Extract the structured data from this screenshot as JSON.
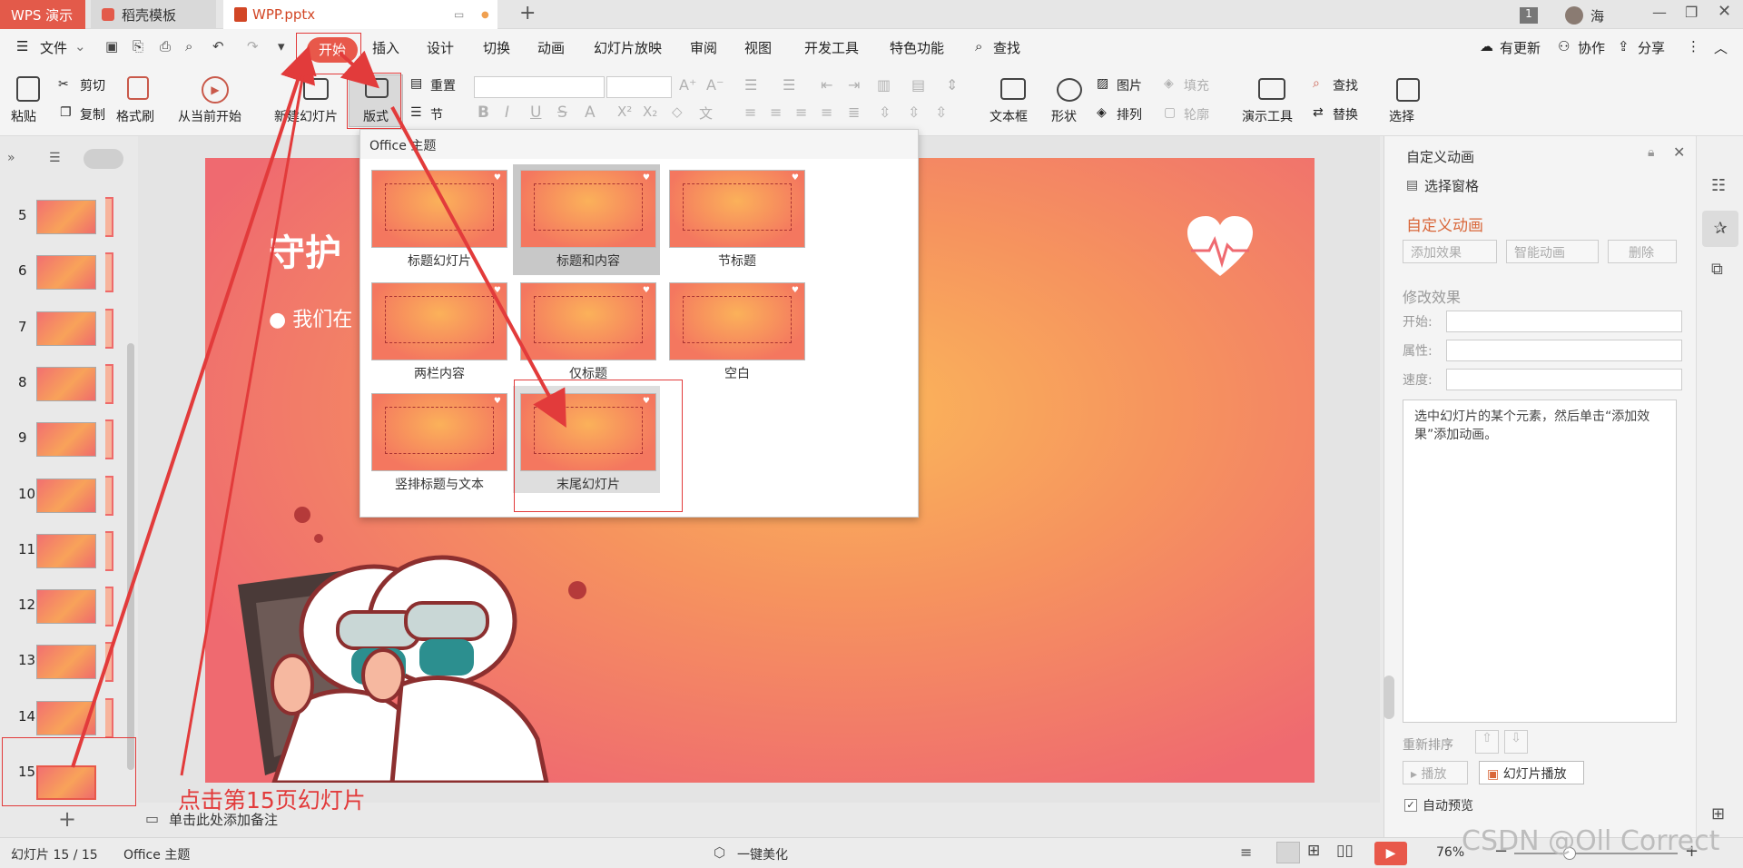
{
  "tabs": {
    "app": "WPS 演示",
    "template": "稻壳模板",
    "file": "WPP.pptx",
    "badge": "1",
    "user": "海"
  },
  "menu": {
    "file": "文件",
    "start": "开始",
    "insert": "插入",
    "design": "设计",
    "transition": "切换",
    "animation": "动画",
    "slideshow": "幻灯片放映",
    "review": "审阅",
    "view": "视图",
    "dev": "开发工具",
    "special": "特色功能",
    "search": "查找",
    "update": "有更新",
    "collab": "协作",
    "share": "分享"
  },
  "ribbon": {
    "paste": "粘贴",
    "cut": "剪切",
    "copy": "复制",
    "format_painter": "格式刷",
    "from_current": "从当前开始",
    "new_slide": "新建幻灯片",
    "layout": "版式",
    "reset": "重置",
    "section": "节",
    "textbox": "文本框",
    "shape": "形状",
    "picture": "图片",
    "fill": "填充",
    "arrange": "排列",
    "outline": "轮廓",
    "present_tools": "演示工具",
    "find": "查找",
    "replace": "替换",
    "select": "选择"
  },
  "slides": {
    "numbers": [
      "5",
      "6",
      "7",
      "8",
      "9",
      "10",
      "11",
      "12",
      "13",
      "14",
      "15"
    ]
  },
  "slide": {
    "title": "守护",
    "bullet": "● 我们在"
  },
  "layout_menu": {
    "header": "Office 主题",
    "items": [
      "标题幻灯片",
      "标题和内容",
      "节标题",
      "两栏内容",
      "仅标题",
      "空白",
      "竖排标题与文本",
      "末尾幻灯片"
    ]
  },
  "annotation": {
    "note": "点击第15页幻灯片"
  },
  "notes": {
    "placeholder": "单击此处添加备注"
  },
  "right": {
    "panel_title": "自定义动画",
    "select_pane": "选择窗格",
    "section_title": "自定义动画",
    "add_effect": "添加效果",
    "smart_anim": "智能动画",
    "delete": "删除",
    "modify": "修改效果",
    "start": "开始:",
    "property": "属性:",
    "speed": "速度:",
    "hint": "选中幻灯片的某个元素，然后单击“添加效果”添加动画。",
    "reorder": "重新排序",
    "play": "播放",
    "slide_play": "幻灯片播放",
    "auto_preview": "自动预览"
  },
  "status": {
    "slide_count": "幻灯片 15 / 15",
    "theme": "Office 主题",
    "beautify": "一键美化",
    "zoom": "76%",
    "watermark": "CSDN @Oll Correct"
  },
  "colors": {
    "accent": "#e8584a",
    "annotation": "#e23b3b"
  }
}
